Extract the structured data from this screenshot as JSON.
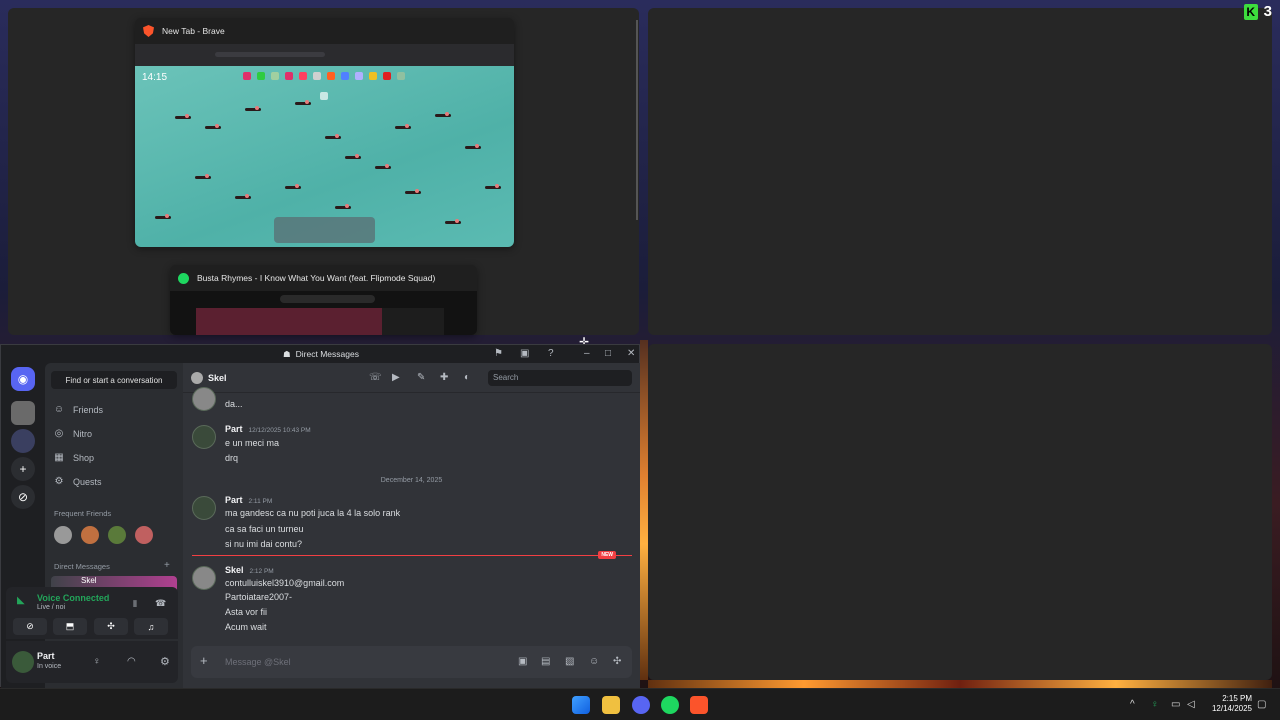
{
  "desktop": {
    "badge_count": "3",
    "badge_logo": "K"
  },
  "switcher": {
    "brave": {
      "title": "New Tab - Brave",
      "clock": "14:15"
    },
    "spotify": {
      "title": "Busta Rhymes - I Know What You Want (feat. Flipmode Squad)"
    }
  },
  "discord": {
    "window_title": "Direct Messages",
    "find_placeholder": "Find or start a conversation",
    "nav": [
      {
        "label": "Friends",
        "icon": "friends-icon"
      },
      {
        "label": "Nitro",
        "icon": "nitro-icon"
      },
      {
        "label": "Shop",
        "icon": "shop-icon"
      },
      {
        "label": "Quests",
        "icon": "quests-icon"
      }
    ],
    "frequent_friends": "Frequent Friends",
    "direct_messages": "Direct Messages",
    "dm_item": "Skel",
    "voice": {
      "status": "Voice Connected",
      "channel": "Live / noi"
    },
    "user": {
      "name": "Part",
      "status": "In voice"
    },
    "header": {
      "name": "Skel",
      "search_placeholder": "Search"
    },
    "messages": {
      "m0_line": "da...",
      "m1": {
        "author": "Part",
        "time": "12/12/2025 10:43 PM",
        "lines": [
          "e un meci ma",
          "drq"
        ]
      },
      "date_divider": "December 14, 2025",
      "m2": {
        "author": "Part",
        "time": "2:11 PM",
        "lines": [
          "ma gandesc ca nu poti juca la 4 la solo rank",
          "ca sa faci un turneu",
          "si nu imi dai contu?"
        ]
      },
      "new_tag": "NEW",
      "m3": {
        "author": "Skel",
        "time": "2:12 PM",
        "lines": [
          "contulluiskel3910@gmail.com",
          "Partoiatare2007-",
          "Asta vor fii",
          "Acum wait"
        ]
      }
    },
    "compose_placeholder": "Message @Skel"
  },
  "taskbar": {
    "time": "2:15 PM",
    "date": "12/14/2025"
  },
  "colors": {
    "discord_blurple": "#5865f2",
    "voice_green": "#23a55a",
    "new_red": "#f23f43"
  }
}
